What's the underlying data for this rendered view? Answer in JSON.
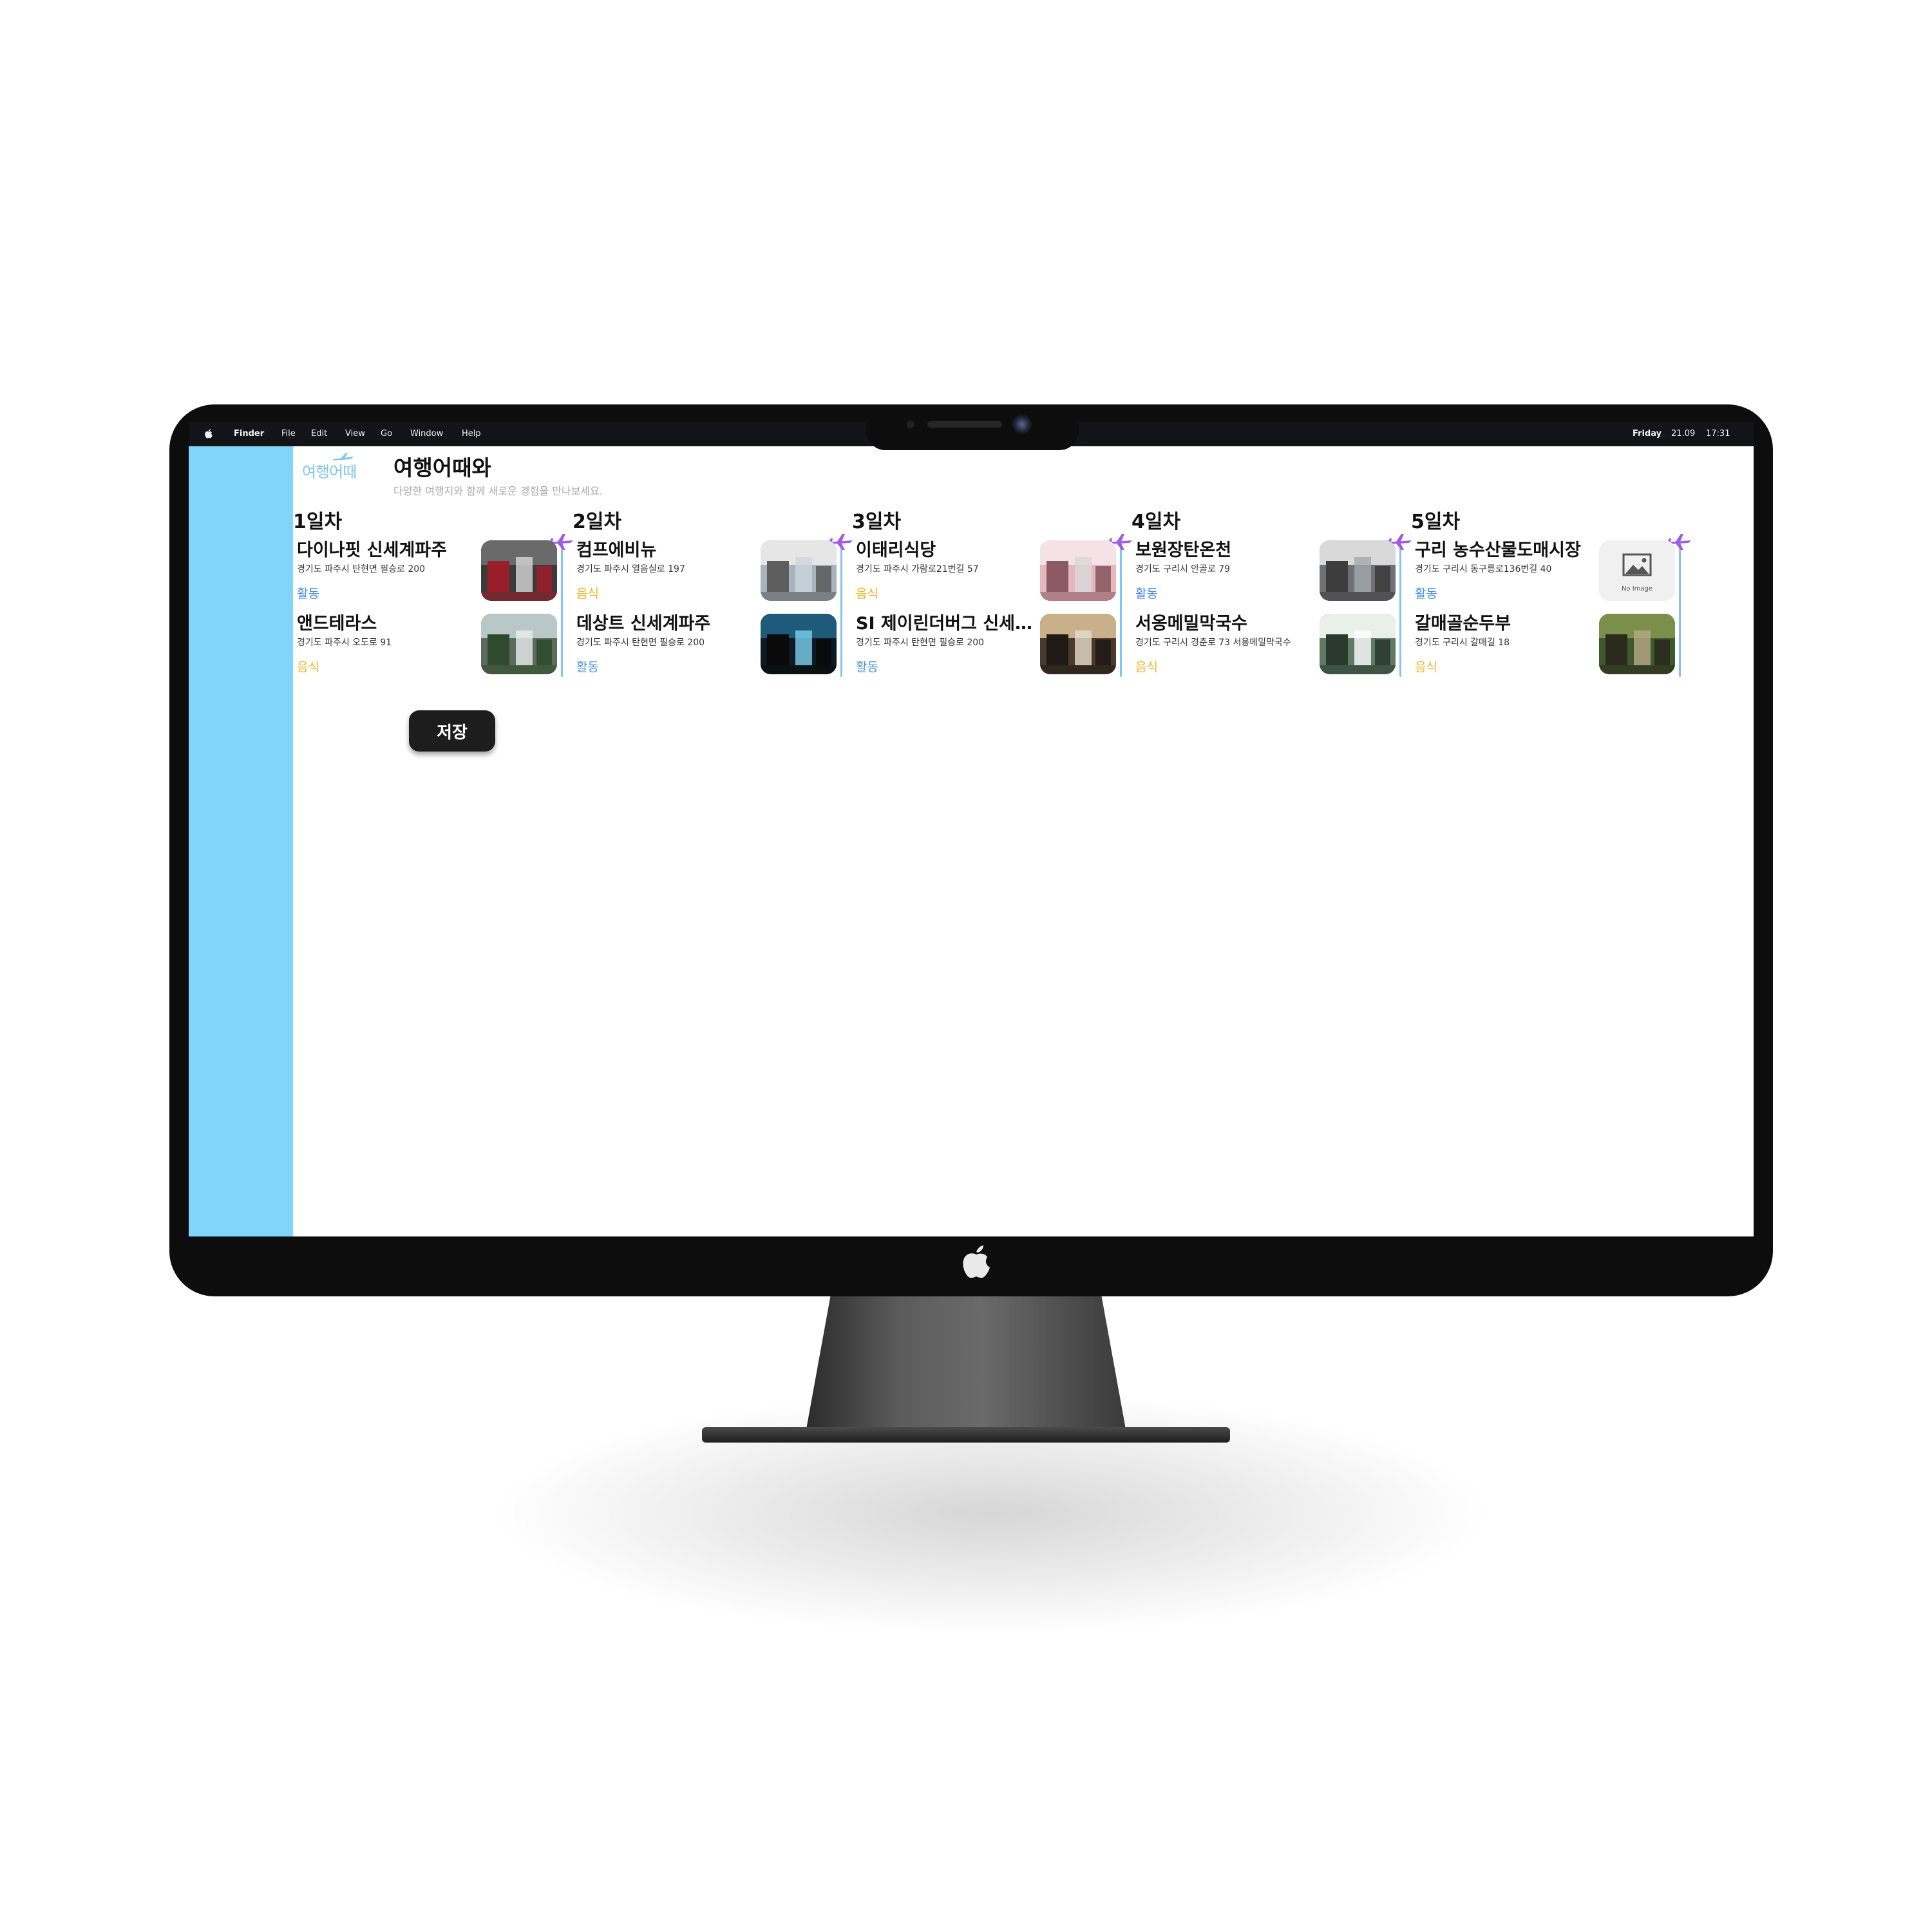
{
  "menubar": {
    "apple_glyph": "",
    "finder": "Finder",
    "items": [
      "File",
      "Edit",
      "View",
      "Go",
      "Window",
      "Help"
    ],
    "day": "Friday",
    "date": "21.09",
    "time": "17:31"
  },
  "app": {
    "logo_text": "여행어때",
    "title": "여행어때와",
    "subtitle": "다양한 여행지와 함께 새로운 경험을 만나보세요."
  },
  "days": [
    {
      "title": "1일차",
      "places": [
        {
          "name": "다이나핏 신세계파주",
          "address": "경기도 파주시 탄현면 필승로 200",
          "category": "활동",
          "photo": "shop-interior"
        },
        {
          "name": "앤드테라스",
          "address": "경기도 파주시 오도로 91",
          "category": "음식",
          "photo": "greenhouse-cafe"
        }
      ]
    },
    {
      "title": "2일차",
      "places": [
        {
          "name": "컴프에비뉴",
          "address": "경기도 파주시 열음실로 197",
          "category": "음식",
          "photo": "building-exterior"
        },
        {
          "name": "데상트 신세계파주",
          "address": "경기도 파주시 탄현면 필승로 200",
          "category": "활동",
          "photo": "dark-store"
        }
      ]
    },
    {
      "title": "3일차",
      "places": [
        {
          "name": "이태리식당",
          "address": "경기도 파주시 가람로21번길 57",
          "category": "음식",
          "photo": "pink-storefront"
        },
        {
          "name": "SI 제이린더버그 신세계파주",
          "address": "경기도 파주시 탄현면 필승로 200",
          "category": "활동",
          "photo": "mall-corridor"
        }
      ]
    },
    {
      "title": "4일차",
      "places": [
        {
          "name": "보원장탄온천",
          "address": "경기도 구리시 안골로 79",
          "category": "활동",
          "photo": "spa-interior"
        },
        {
          "name": "서옹메밀막국수",
          "address": "경기도 구리시 경춘로 73 서옹메밀막국수",
          "category": "음식",
          "photo": "restaurant-car"
        }
      ]
    },
    {
      "title": "5일차",
      "places": [
        {
          "name": "구리 농수산물도매시장",
          "address": "경기도 구리시 동구릉로136번길 40",
          "category": "활동",
          "photo": "placeholder"
        },
        {
          "name": "갈매골순두부",
          "address": "경기도 구리시 갈매길 18",
          "category": "음식",
          "photo": "ivy-building"
        }
      ]
    }
  ],
  "placeholder_caption": "No Image",
  "save_label": "저장",
  "colors": {
    "sidebar": "#81d4fa",
    "activity": "#4a8fe0",
    "food": "#f5b323",
    "divider": "#81c4ec",
    "plane": "#a259e6",
    "button": "#1d1d1d"
  }
}
